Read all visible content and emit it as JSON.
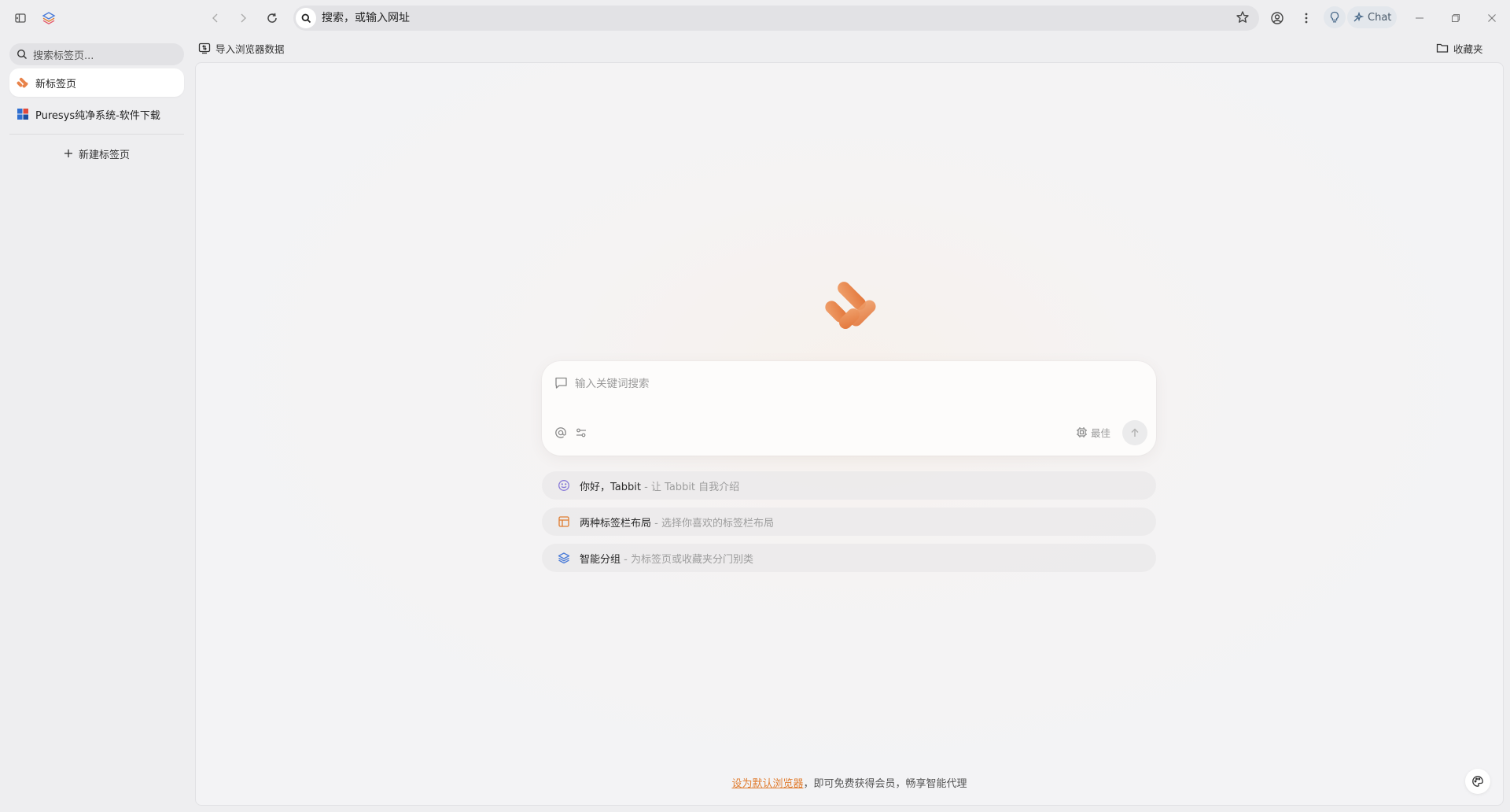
{
  "toolbar": {
    "address_text": "搜索，或输入网址",
    "chat_label": "Chat"
  },
  "sidebar": {
    "search_placeholder": "搜索标签页...",
    "tabs": [
      {
        "label": "新标签页",
        "active": true
      },
      {
        "label": "Puresys纯净系统-软件下载",
        "active": false
      }
    ],
    "new_tab_label": "新建标签页"
  },
  "bookmarks_bar": {
    "import_label": "导入浏览器数据",
    "favorites_label": "收藏夹"
  },
  "main": {
    "search_placeholder": "输入关键词搜索",
    "model_label": "最佳",
    "suggestions": [
      {
        "title": "你好，Tabbit",
        "desc": " - 让 Tabbit 自我介绍",
        "icon": "smile-icon"
      },
      {
        "title": "两种标签栏布局",
        "desc": " - 选择你喜欢的标签栏布局",
        "icon": "layout-icon"
      },
      {
        "title": "智能分组",
        "desc": " - 为标签页或收藏夹分门别类",
        "icon": "layers-icon"
      }
    ],
    "footer_link": "设为默认浏览器",
    "footer_text": "，即可免费获得会员，畅享智能代理"
  },
  "colors": {
    "accent": "#e07c2f",
    "logo": "#e8834a"
  }
}
